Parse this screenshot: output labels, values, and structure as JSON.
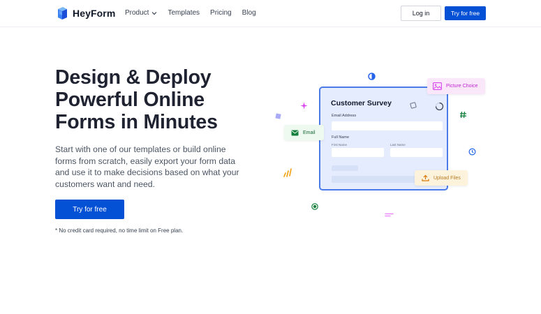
{
  "nav": {
    "logo_text": "HeyForm",
    "links": [
      {
        "label": "Product"
      },
      {
        "label": "Templates"
      },
      {
        "label": "Pricing"
      },
      {
        "label": "Blog"
      }
    ],
    "login_label": "Log in",
    "try_label": "Try for free"
  },
  "hero": {
    "title_lines": [
      "Design & Deploy",
      "Powerful Online",
      "Forms in Minutes"
    ],
    "subtitle": "Start with one of our templates or build online forms from scratch, easily export your form data and use it to make decisions based on what your customers want and need.",
    "cta_label": "Try for free",
    "note": "* No credit card required, no time limit on Free plan."
  },
  "illustration": {
    "survey_title": "Customer Survey",
    "email_address_label": "Email Address",
    "full_name_label": "Full Name",
    "first_name_label": "First Name",
    "last_name_label": "Last Name",
    "tags": {
      "email": "Email",
      "picture_choice": "Picture Choice",
      "upload_files": "Upload Files"
    }
  },
  "colors": {
    "brand_blue": "#0551d6",
    "title_text": "#1f2230",
    "card_bg": "#e5ecfd",
    "card_border": "#4a7be8",
    "email_green": "#166534",
    "picture_pink": "#c026d3",
    "upload_amber": "#b7791f"
  },
  "icons": {
    "logo": "heyform-cube-logo",
    "product_menu": "chevron-down-icon",
    "email": "mail-icon",
    "picture_choice": "image-icon",
    "upload_files": "upload-icon"
  }
}
